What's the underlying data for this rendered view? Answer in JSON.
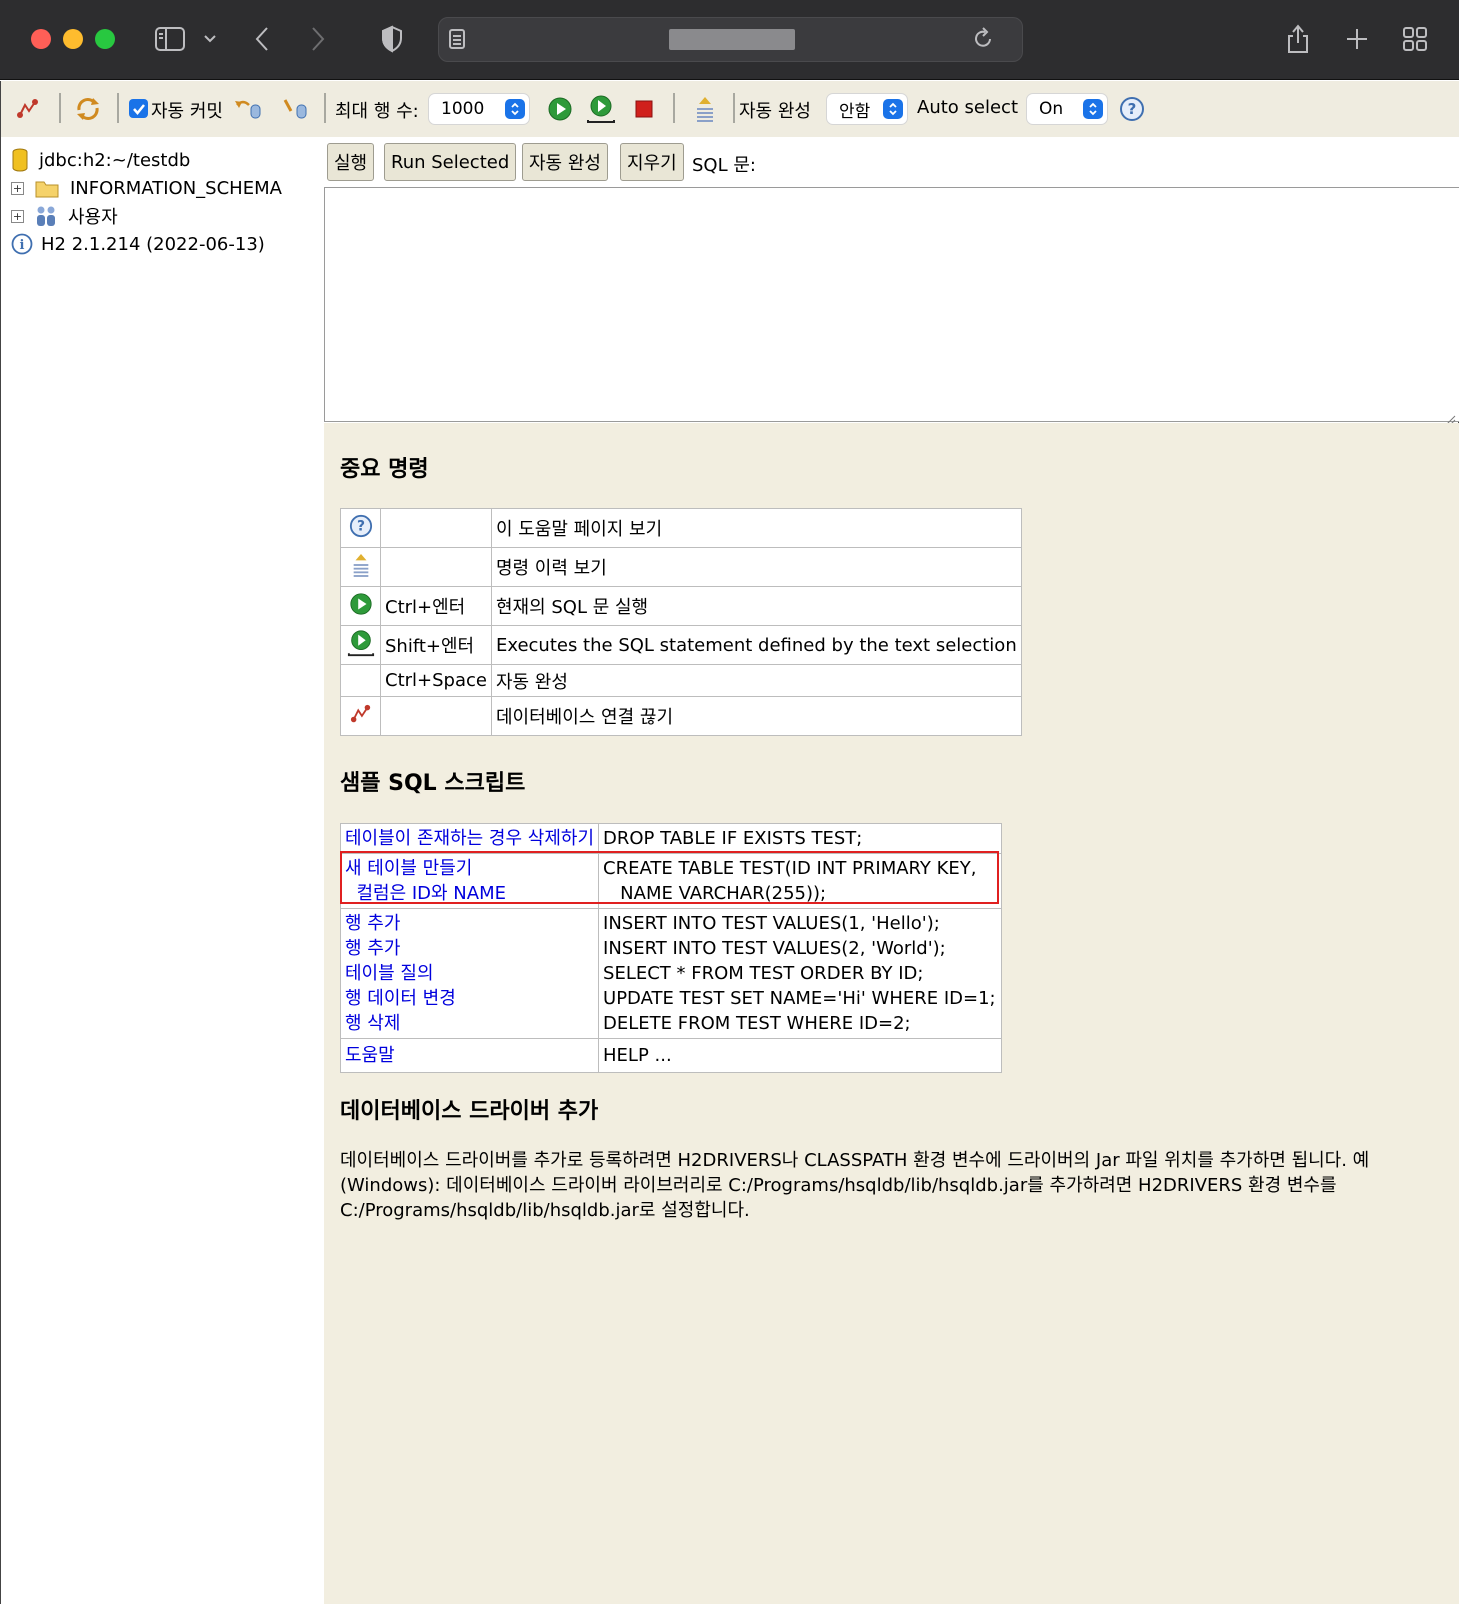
{
  "browser": {
    "icons": [
      "sidebar-icon",
      "chevron-down-icon",
      "back-icon",
      "forward-icon",
      "shield-icon",
      "reader-icon",
      "reload-icon",
      "share-icon",
      "new-tab-icon",
      "tab-overview-icon"
    ]
  },
  "toolbar": {
    "autocommit_label": "자동 커밋",
    "autocommit_checked": true,
    "maxrows_label": "최대 행 수:",
    "maxrows_value": "1000",
    "autocomplete_label": "자동 완성",
    "autocomplete_value": "안함",
    "autoselect_label": "Auto select",
    "autoselect_value": "On"
  },
  "tree": {
    "items": [
      {
        "label": "jdbc:h2:~/testdb",
        "icon": "database-icon"
      },
      {
        "label": "INFORMATION_SCHEMA",
        "icon": "folder-icon",
        "expandable": true
      },
      {
        "label": "사용자",
        "icon": "users-icon",
        "expandable": true
      },
      {
        "label": "H2 2.1.214 (2022-06-13)",
        "icon": "info-icon"
      }
    ]
  },
  "query": {
    "buttons": {
      "run": "실행",
      "run_selected": "Run Selected",
      "autocomplete": "자동 완성",
      "clear": "지우기"
    },
    "sql_label": "SQL 문:",
    "sql_text": ""
  },
  "help": {
    "important_title": "중요 명령",
    "commands": [
      {
        "icon": "help-icon",
        "key": "",
        "desc": "이 도움말 페이지 보기"
      },
      {
        "icon": "history-icon",
        "key": "",
        "desc": "명령 이력 보기"
      },
      {
        "icon": "run-icon",
        "key": "Ctrl+엔터",
        "desc": "현재의 SQL 문 실행"
      },
      {
        "icon": "run-selected-icon",
        "key": "Shift+엔터",
        "desc": "Executes the SQL statement defined by the text selection"
      },
      {
        "icon": "",
        "key": "Ctrl+Space",
        "desc": "자동 완성"
      },
      {
        "icon": "disconnect-icon",
        "key": "",
        "desc": "데이터베이스 연결 끊기"
      }
    ],
    "sample_title": "샘플 SQL 스크립트",
    "samples": [
      {
        "label": "테이블이 존재하는 경우 삭제하기",
        "code": "DROP TABLE IF EXISTS TEST;"
      },
      {
        "label": "새 테이블 만들기",
        "label2": "  컬럼은 ID와 NAME",
        "code": "CREATE TABLE TEST(ID INT PRIMARY KEY,",
        "code2": "   NAME VARCHAR(255));"
      },
      {
        "label": "행 추가",
        "code": "INSERT INTO TEST VALUES(1, 'Hello');"
      },
      {
        "label": "행 추가",
        "code": "INSERT INTO TEST VALUES(2, 'World');"
      },
      {
        "label": "테이블 질의",
        "code": "SELECT * FROM TEST ORDER BY ID;"
      },
      {
        "label": "행 데이터 변경",
        "code": "UPDATE TEST SET NAME='Hi' WHERE ID=1;"
      },
      {
        "label": "행 삭제",
        "code": "DELETE FROM TEST WHERE ID=2;"
      },
      {
        "label": "도움말",
        "code": "HELP ..."
      }
    ],
    "driver_title": "데이터베이스 드라이버 추가",
    "driver_text": "데이터베이스 드라이버를 추가로 등록하려면 H2DRIVERS나 CLASSPATH 환경 변수에 드라이버의 Jar 파일 위치를 추가하면 됩니다. 예 (Windows): 데이터베이스 드라이버 라이브러리로 C:/Programs/hsqldb/lib/hsqldb.jar를 추가하려면 H2DRIVERS 환경 변수를 C:/Programs/hsqldb/lib/hsqldb.jar로 설정합니다."
  }
}
